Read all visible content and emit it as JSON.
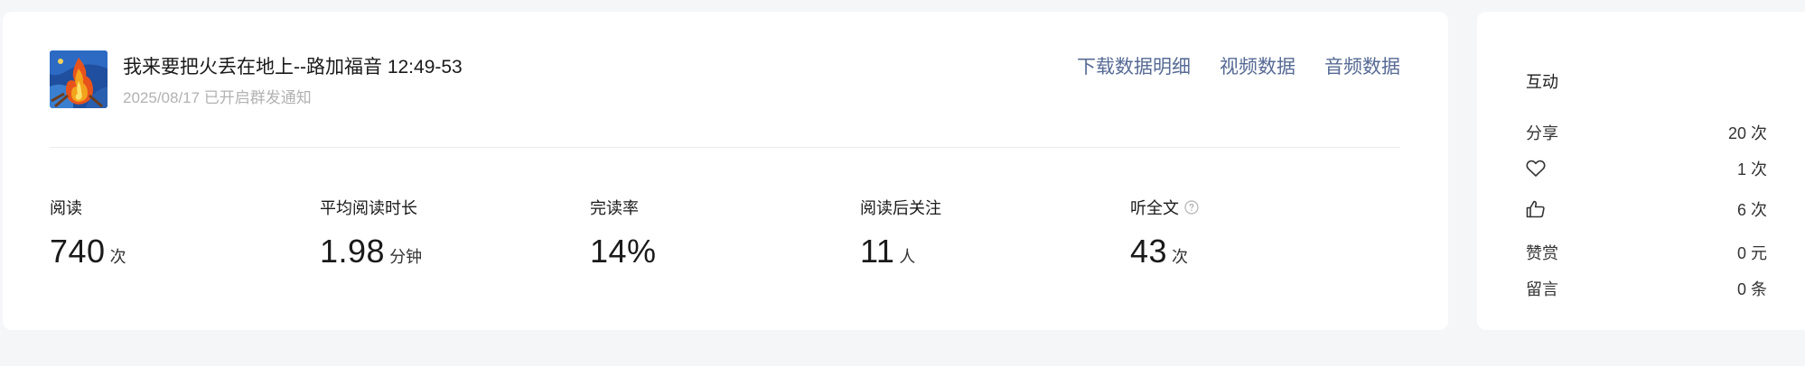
{
  "article": {
    "title": "我来要把火丢在地上--路加福音 12:49-53",
    "meta": "2025/08/17 已开启群发通知",
    "thumbnail_icon": "fire-painting-thumbnail"
  },
  "links": [
    {
      "label": "下载数据明细"
    },
    {
      "label": "视频数据"
    },
    {
      "label": "音频数据"
    }
  ],
  "stats": [
    {
      "label": "阅读",
      "value": "740",
      "unit": "次"
    },
    {
      "label": "平均阅读时长",
      "value": "1.98",
      "unit": "分钟"
    },
    {
      "label": "完读率",
      "value": "14%",
      "unit": ""
    },
    {
      "label": "阅读后关注",
      "value": "11",
      "unit": "人"
    },
    {
      "label": "听全文",
      "value": "43",
      "unit": "次",
      "help_icon": "question-circle-icon"
    }
  ],
  "interaction": {
    "title": "互动",
    "rows": [
      {
        "label": "分享",
        "value": "20 次"
      },
      {
        "icon": "heart-icon",
        "value": "1 次"
      },
      {
        "icon": "thumbs-up-icon",
        "value": "6 次"
      },
      {
        "label": "赞赏",
        "value": "0 元"
      },
      {
        "label": "留言",
        "value": "0 条"
      }
    ]
  },
  "colors": {
    "link": "#576b95",
    "background": "#f5f6f8",
    "card": "#ffffff",
    "muted": "#b2b2b2"
  }
}
